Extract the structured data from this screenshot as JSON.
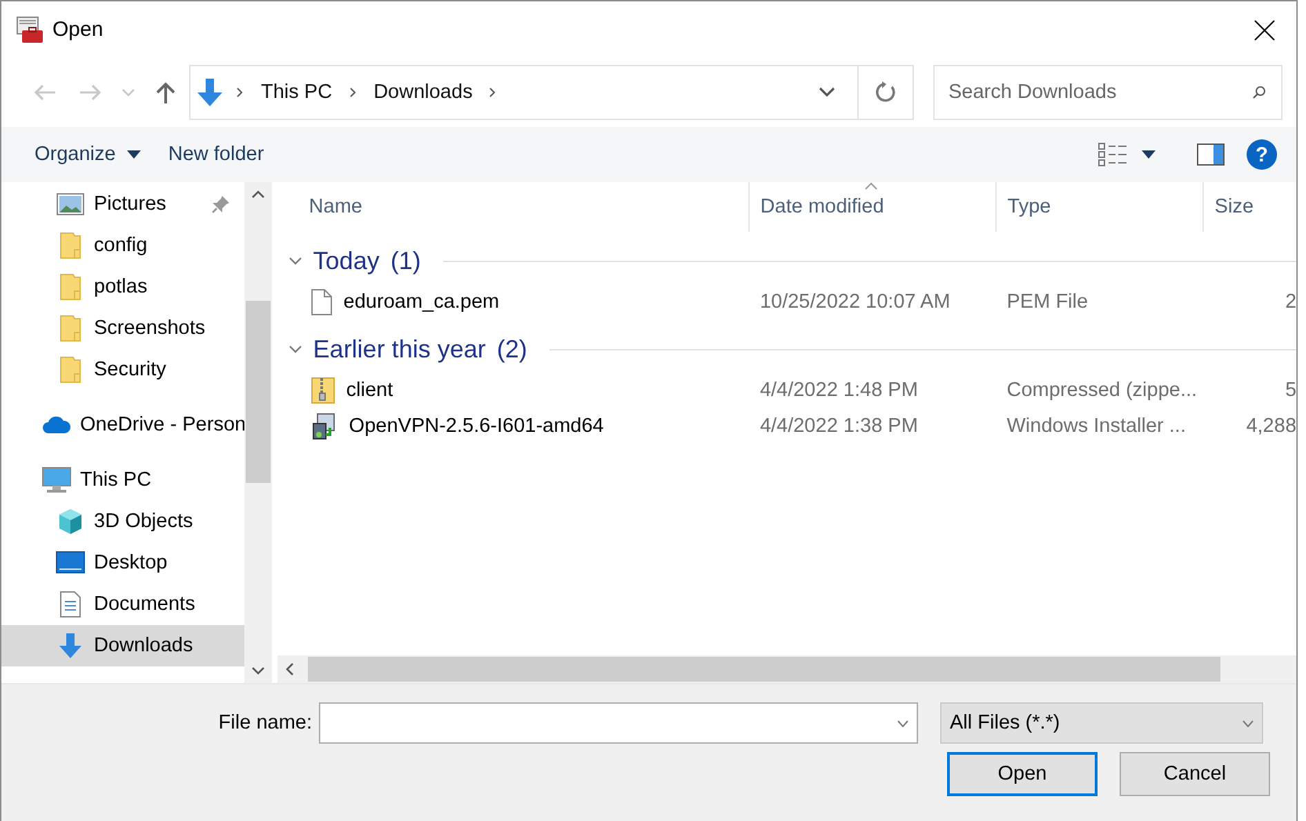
{
  "window": {
    "title": "Open"
  },
  "nav_buttons": [
    {
      "kind": "back",
      "disabled": true
    },
    {
      "kind": "forward",
      "disabled": true
    },
    {
      "kind": "recent",
      "disabled": true
    },
    {
      "kind": "up",
      "disabled": false
    }
  ],
  "address": {
    "crumbs": [
      "This PC",
      "Downloads"
    ]
  },
  "search": {
    "placeholder": "Search Downloads"
  },
  "toolbar": {
    "organize": "Organize",
    "new_folder": "New folder",
    "help": "?"
  },
  "sidebar": {
    "quick_access": [
      {
        "label": "Pictures",
        "kind": "pictures",
        "pinned": true,
        "selected": false
      },
      {
        "label": "config",
        "kind": "folder",
        "pinned": false,
        "selected": false
      },
      {
        "label": "potlas",
        "kind": "folder",
        "pinned": false,
        "selected": false
      },
      {
        "label": "Screenshots",
        "kind": "folder",
        "pinned": false,
        "selected": false
      },
      {
        "label": "Security",
        "kind": "folder",
        "pinned": false,
        "selected": false
      }
    ],
    "roots": [
      {
        "label": "OneDrive - Person",
        "kind": "onedrive",
        "selected": false
      },
      {
        "label": "This PC",
        "kind": "pc",
        "selected": false,
        "children": [
          {
            "label": "3D Objects",
            "kind": "objects3d",
            "selected": false
          },
          {
            "label": "Desktop",
            "kind": "desktop",
            "selected": false
          },
          {
            "label": "Documents",
            "kind": "documents",
            "selected": false
          },
          {
            "label": "Downloads",
            "kind": "downloads",
            "selected": true
          }
        ]
      }
    ]
  },
  "table": {
    "columns": [
      "Name",
      "Date modified",
      "Type",
      "Size"
    ],
    "groups": [
      {
        "label": "Today",
        "count": "(1)",
        "expanded": true,
        "files": [
          {
            "name": "eduroam_ca.pem",
            "kind": "document",
            "date": "10/25/2022 10:07 AM",
            "type": "PEM File",
            "size": "2"
          }
        ]
      },
      {
        "label": "Earlier this year",
        "count": "(2)",
        "expanded": true,
        "files": [
          {
            "name": "client",
            "kind": "zip",
            "date": "4/4/2022 1:48 PM",
            "type": "Compressed (zippe...",
            "size": "5"
          },
          {
            "name": "OpenVPN-2.5.6-I601-amd64",
            "kind": "installer",
            "date": "4/4/2022 1:38 PM",
            "type": "Windows Installer ...",
            "size": "4,288"
          }
        ]
      }
    ]
  },
  "footer": {
    "file_name_label": "File name:",
    "filter": "All Files (*.*)",
    "buttons": [
      {
        "label": "Open",
        "default": true
      },
      {
        "label": "Cancel",
        "default": false
      }
    ]
  }
}
